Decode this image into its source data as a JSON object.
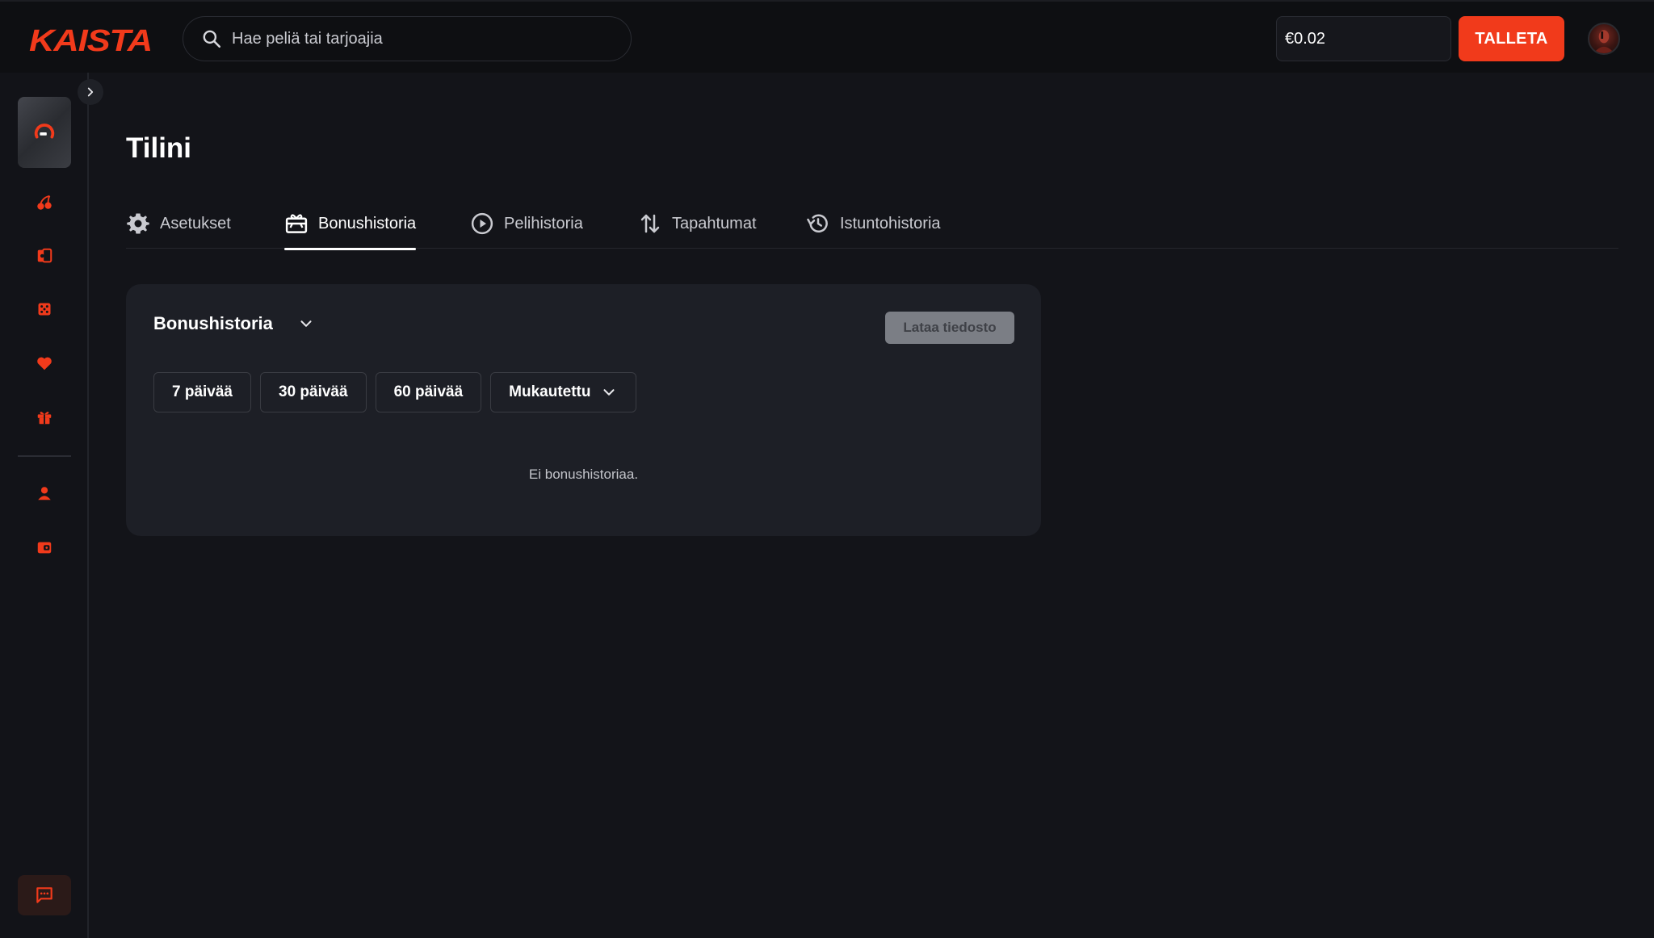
{
  "brand": {
    "name": "KAISTA"
  },
  "search": {
    "placeholder": "Hae peliä tai tarjoajia"
  },
  "balance": {
    "value": "€0.02"
  },
  "header": {
    "deposit_label": "TALLETA"
  },
  "sidebar": {
    "items": [
      {
        "icon": "cherries-icon"
      },
      {
        "icon": "cards-icon"
      },
      {
        "icon": "dice-icon"
      },
      {
        "icon": "heart-icon"
      },
      {
        "icon": "gift-icon"
      },
      {
        "icon": "user-icon"
      },
      {
        "icon": "wallet-icon"
      }
    ],
    "chat_icon": "chat-icon"
  },
  "page": {
    "title": "Tilini"
  },
  "tabs": [
    {
      "label": "Asetukset",
      "icon": "gear-icon",
      "active": false
    },
    {
      "label": "Bonushistoria",
      "icon": "gift-card-icon",
      "active": true
    },
    {
      "label": "Pelihistoria",
      "icon": "play-circle-icon",
      "active": false
    },
    {
      "label": "Tapahtumat",
      "icon": "transfer-arrows-icon",
      "active": false
    },
    {
      "label": "Istuntohistoria",
      "icon": "history-icon",
      "active": false
    }
  ],
  "card": {
    "title": "Bonushistoria",
    "download_label": "Lataa tiedosto",
    "filters": [
      "7 päivää",
      "30 päivää",
      "60 päivää"
    ],
    "custom_label": "Mukautettu",
    "empty_text": "Ei bonushistoriaa."
  },
  "colors": {
    "accent": "#f13a1b",
    "background": "#131419",
    "card": "#1d1f26"
  }
}
